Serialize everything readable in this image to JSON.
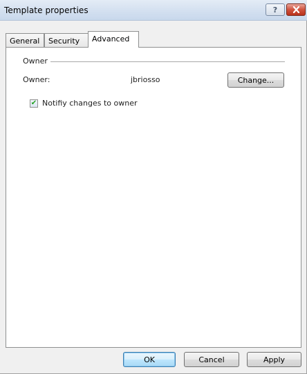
{
  "window": {
    "title": "Template properties"
  },
  "title_bar": {
    "help_glyph": "?",
    "close_glyph": "✕"
  },
  "tabs": [
    {
      "label": "General",
      "active": false
    },
    {
      "label": "Security",
      "active": false
    },
    {
      "label": "Advanced",
      "active": true
    }
  ],
  "owner_group": {
    "title": "Owner",
    "owner_label": "Owner:",
    "owner_value": "jbriosso",
    "change_label": "Change...",
    "notify_label": "Notifiy changes to owner",
    "notify_checked": true
  },
  "footer": {
    "ok_label": "OK",
    "cancel_label": "Cancel",
    "apply_label": "Apply"
  },
  "colors": {
    "title_bar": "#d6e2f1",
    "close_button": "#d0533f",
    "default_button_border": "#3c7fb1",
    "check_mark": "#21a121"
  },
  "icons": [
    "help-icon",
    "close-icon",
    "checkmark-icon"
  ]
}
